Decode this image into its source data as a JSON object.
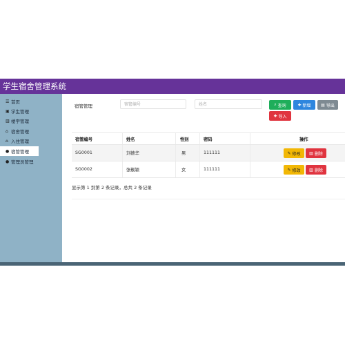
{
  "app": {
    "title": "学生宿舍管理系统"
  },
  "sidebar": {
    "items": [
      {
        "label": "首页",
        "icon": "list-icon"
      },
      {
        "label": "学生管理",
        "icon": "student-card-icon"
      },
      {
        "label": "楼宇管理",
        "icon": "building-icon"
      },
      {
        "label": "宿舍管理",
        "icon": "home-icon"
      },
      {
        "label": "入住管理",
        "icon": "home-icon"
      },
      {
        "label": "宿管管理",
        "icon": "user-icon",
        "active": true
      },
      {
        "label": "管理员管理",
        "icon": "user-icon"
      }
    ]
  },
  "filter": {
    "label": "宿管管理",
    "id_placeholder": "宿管编号",
    "name_placeholder": "姓名",
    "search_label": "查询",
    "add_label": "新增",
    "export_label": "导出",
    "import_label": "导入"
  },
  "table": {
    "headers": [
      "宿管编号",
      "姓名",
      "性别",
      "密码",
      "操作"
    ],
    "rows": [
      {
        "id": "SG0001",
        "name": "刘德华",
        "gender": "男",
        "password": "111111"
      },
      {
        "id": "SG0002",
        "name": "张靓颖",
        "gender": "女",
        "password": "111111"
      }
    ],
    "edit_label": "修改",
    "delete_label": "删除"
  },
  "pagination": {
    "summary": "显示第 1 到第 2 条记录，总共 2 条记录"
  },
  "colors": {
    "header": "#663399",
    "sidebar": "#8fb2c6",
    "search": "#1eae5a",
    "add": "#2e86de",
    "export": "#7e8a92",
    "import": "#e0343f",
    "edit": "#f2b705",
    "delete": "#e0343f"
  }
}
